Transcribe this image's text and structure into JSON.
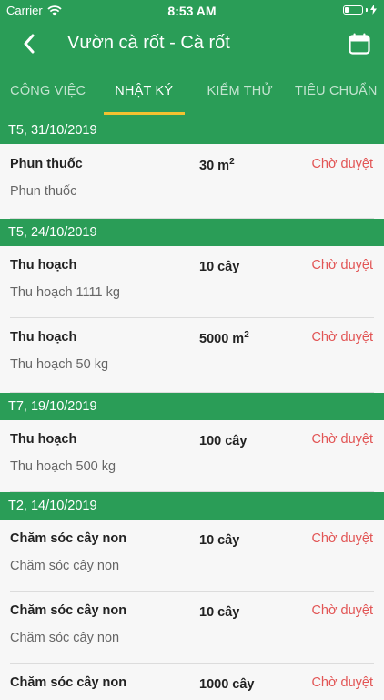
{
  "status_bar": {
    "carrier": "Carrier",
    "time": "8:53 AM"
  },
  "navbar": {
    "title": "Vườn cà rốt - Cà rốt",
    "back_icon": "chevron-left-icon",
    "calendar_icon": "calendar-icon"
  },
  "tabs": [
    {
      "label": "CÔNG VIỆC",
      "active": false
    },
    {
      "label": "NHẬT KÝ",
      "active": true
    },
    {
      "label": "KIỂM THỬ",
      "active": false
    },
    {
      "label": "TIÊU CHUẨN",
      "active": false
    }
  ],
  "colors": {
    "primary": "#2a9d57",
    "tab_indicator": "#f2c230",
    "pending": "#e25555"
  },
  "log": [
    {
      "date": "T5, 31/10/2019",
      "items": [
        {
          "name": "Phun thuốc",
          "qty": "30 m",
          "qty_sup": "2",
          "status": "Chờ duyệt",
          "desc": "Phun thuốc"
        }
      ]
    },
    {
      "date": "T5, 24/10/2019",
      "items": [
        {
          "name": "Thu hoạch",
          "qty": "10 cây",
          "qty_sup": "",
          "status": "Chờ duyệt",
          "desc": "Thu hoạch 1111 kg"
        },
        {
          "name": "Thu hoạch",
          "qty": "5000 m",
          "qty_sup": "2",
          "status": "Chờ duyệt",
          "desc": "Thu hoạch 50 kg"
        }
      ]
    },
    {
      "date": "T7, 19/10/2019",
      "items": [
        {
          "name": "Thu hoạch",
          "qty": "100 cây",
          "qty_sup": "",
          "status": "Chờ duyệt",
          "desc": "Thu hoạch 500 kg"
        }
      ]
    },
    {
      "date": "T2, 14/10/2019",
      "items": [
        {
          "name": "Chăm sóc cây non",
          "qty": "10 cây",
          "qty_sup": "",
          "status": "Chờ duyệt",
          "desc": "Chăm sóc cây non"
        },
        {
          "name": "Chăm sóc cây non",
          "qty": "10 cây",
          "qty_sup": "",
          "status": "Chờ duyệt",
          "desc": "Chăm sóc cây non"
        },
        {
          "name": "Chăm sóc cây non",
          "qty": "1000 cây",
          "qty_sup": "",
          "status": "Chờ duyệt",
          "desc": ""
        }
      ]
    }
  ]
}
